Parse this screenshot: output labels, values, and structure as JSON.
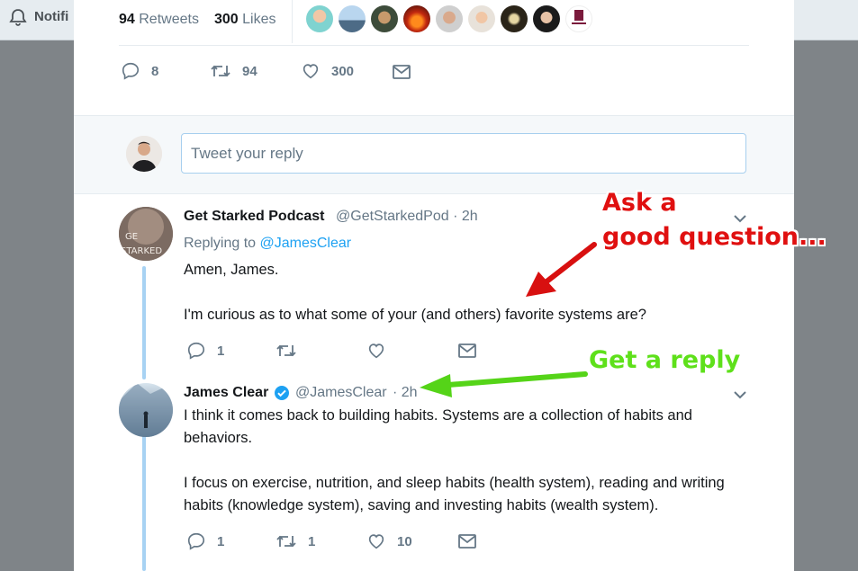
{
  "topbar": {
    "notifications_label": "Notifi"
  },
  "stats": {
    "retweets_count": "94",
    "retweets_label": "Retweets",
    "likes_count": "300",
    "likes_label": "Likes"
  },
  "main_actions": {
    "replies": "8",
    "retweets": "94",
    "likes": "300"
  },
  "reply_box": {
    "placeholder": "Tweet your reply"
  },
  "reply1": {
    "name": "Get Starked Podcast",
    "handle": "@GetStarkedPod · 2h",
    "replying_prefix": "Replying to",
    "replying_to": "@JamesClear",
    "text1": "Amen, James.",
    "text2": "I'm curious as to what some of your (and others) favorite systems are?",
    "replies": "1",
    "retweets": "",
    "likes": "",
    "avatar_text1": "GE",
    "avatar_text2": "STARKED"
  },
  "reply2": {
    "name": "James Clear",
    "handle": "@JamesClear",
    "time": "· 2h",
    "text1": "I think it comes back to building habits. Systems are a collection of habits and behaviors.",
    "text2": "I focus on exercise, nutrition, and sleep habits (health system), reading and writing habits (knowledge system), saving and investing habits (wealth system).",
    "replies": "1",
    "retweets": "1",
    "likes": "10"
  },
  "annotations": {
    "ask_line1": "Ask a",
    "ask_line2": "good question...",
    "reply_note": "Get a reply"
  },
  "colors": {
    "accent": "#1da1f2",
    "thread": "#a7d2f3",
    "annotation_red": "#e01010",
    "annotation_green": "#5ee01a"
  }
}
